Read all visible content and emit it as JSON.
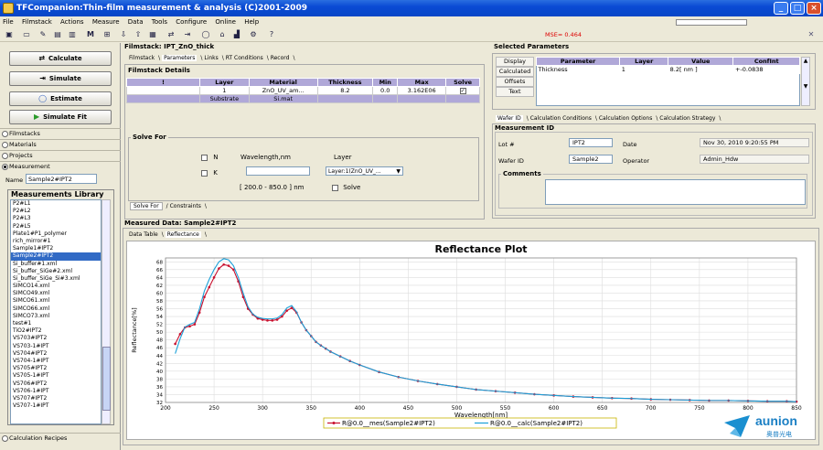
{
  "window": {
    "title": "TFCompanion:Thin-film measurement & analysis (C)2001-2009"
  },
  "menu": [
    "File",
    "Filmstack",
    "Actions",
    "Measure",
    "Data",
    "Tools",
    "Configure",
    "Online",
    "Help"
  ],
  "status": {
    "mse": "MSE= 0.464"
  },
  "left": {
    "buttons": {
      "calculate": "Calculate",
      "simulate": "Simulate",
      "estimate": "Estimate",
      "simulate_fit": "Simulate Fit"
    },
    "nav": [
      "Filmstacks",
      "Materials",
      "Projects",
      "Measurement"
    ],
    "name_label": "Name",
    "name_value": "Sample2#IPT2",
    "library_title": "Measurements Library",
    "library": [
      "P2#L1",
      "P2#L2",
      "P2#L3",
      "P2#L5",
      "Plate1#P1_polymer",
      "rich_mirror#1",
      "Sample1#IPT2",
      "Sample2#IPT2",
      "Si_buffer#1.xml",
      "Si_buffer_SiGe#2.xml",
      "Si_buffer_SiGe_Si#3.xml",
      "SIMCO14.xml",
      "SIMCO49.xml",
      "SIMCO61.xml",
      "SIMCO66.xml",
      "SIMCO73.xml",
      "test#1",
      "TiO2#IPT2",
      "VS703#IPT2",
      "VS703-1#IPT",
      "VS704#IPT2",
      "VS704-1#IPT",
      "VS705#IPT2",
      "VS705-1#IPT",
      "VS706#IPT2",
      "VS706-1#IPT",
      "VS707#IPT2",
      "VS707-1#IPT"
    ],
    "calc_recipes": "Calculation Recipes"
  },
  "filmstack": {
    "title": "Filmstack: IPT_ZnO_thick",
    "tabs": [
      "Filmstack",
      "Parameters",
      "Links",
      "RT Conditions",
      "Record"
    ],
    "details_title": "Filmstack Details",
    "headers": [
      "!",
      "Layer",
      "Material",
      "Thickness",
      "Min",
      "Max",
      "Solve"
    ],
    "row": {
      "layer": "1",
      "material": "ZnO_UV_am...",
      "thickness": "8.2",
      "min": "0.0",
      "max": "3.162E06"
    },
    "substrate": {
      "label": "Substrate",
      "material": "Si.mat"
    },
    "solve_for": {
      "title": "Solve For",
      "n_label": "N",
      "k_label": "K",
      "wavelength_label": "Wavelength,nm",
      "layer_label": "Layer",
      "layer_value": "Layer:1(ZnO_UV_...",
      "range": "[ 200.0 - 850.0 ] nm",
      "solve_label": "Solve"
    },
    "bottom_tabs": [
      "Solve For",
      "Constraints"
    ]
  },
  "selected": {
    "title": "Selected Parameters",
    "side_buttons": [
      "Display",
      "Calculated",
      "Offsets",
      "Text"
    ],
    "headers": [
      "Parameter",
      "Layer",
      "Value",
      "ConfInt"
    ],
    "row": {
      "parameter": "Thickness",
      "layer": "1",
      "value": "8.2[ nm ]",
      "confint": "+-0.0838"
    }
  },
  "wafer": {
    "tabs": [
      "Wafer ID",
      "Calculation Conditions",
      "Calculation Options",
      "Calculation Strategy"
    ],
    "measurement_id": "Measurement ID",
    "lot_label": "Lot #",
    "lot_value": "IPT2",
    "date_label": "Date",
    "date_value": "Nov 30, 2010 9:20:55 PM",
    "wafer_label": "Wafer ID",
    "wafer_value": "Sample2",
    "operator_label": "Operator",
    "operator_value": "Admin_Hdw",
    "comments_label": "Comments"
  },
  "measured": {
    "title": "Measured Data: Sample2#IPT2",
    "tabs": [
      "Data Table",
      "Reflectance"
    ]
  },
  "logo": {
    "text": "aunion",
    "subtext": "奥普光电"
  },
  "colors": {
    "measured": "#c8102e",
    "calculated": "#1aa0d8",
    "accent": "#316ac5"
  },
  "chart_data": {
    "type": "line",
    "title": "Reflectance Plot",
    "xlabel": "Wavelength[nm]",
    "ylabel": "Reflectance[%]",
    "xlim": [
      200,
      850
    ],
    "ylim": [
      32,
      69
    ],
    "xticks": [
      200,
      250,
      300,
      350,
      400,
      450,
      500,
      550,
      600,
      650,
      700,
      750,
      800,
      850
    ],
    "yticks": [
      32,
      34,
      36,
      38,
      40,
      42,
      44,
      46,
      48,
      50,
      52,
      54,
      56,
      58,
      60,
      62,
      64,
      66,
      68
    ],
    "grid": true,
    "legend_position": "bottom",
    "series": [
      {
        "name": "R@0.0__mes(Sample2#IPT2)",
        "x": [
          210,
          215,
          220,
          225,
          230,
          235,
          240,
          245,
          250,
          255,
          260,
          265,
          270,
          275,
          280,
          285,
          290,
          295,
          300,
          305,
          310,
          315,
          320,
          325,
          330,
          335,
          340,
          345,
          350,
          355,
          360,
          365,
          370,
          380,
          390,
          400,
          420,
          440,
          460,
          480,
          500,
          520,
          540,
          560,
          580,
          600,
          620,
          640,
          660,
          680,
          700,
          720,
          740,
          760,
          780,
          800,
          820,
          840,
          850
        ],
        "y": [
          47,
          49.5,
          51.2,
          51.5,
          52,
          55,
          59,
          61.5,
          64,
          66.3,
          67.3,
          67,
          66,
          63,
          59,
          56,
          54.5,
          53.5,
          53.2,
          53,
          53,
          53.2,
          54,
          55.5,
          56.2,
          55,
          52.5,
          50.5,
          49,
          47.5,
          46.6,
          45.8,
          45,
          43.8,
          42.6,
          41.6,
          39.8,
          38.5,
          37.5,
          36.7,
          36,
          35.3,
          34.9,
          34.5,
          34.1,
          33.8,
          33.5,
          33.3,
          33.1,
          33,
          32.8,
          32.7,
          32.6,
          32.5,
          32.5,
          32.4,
          32.3,
          32.3,
          32.2
        ]
      },
      {
        "name": "R@0.0__calc(Sample2#IPT2)",
        "x": [
          210,
          215,
          220,
          225,
          230,
          235,
          240,
          245,
          250,
          255,
          260,
          265,
          270,
          275,
          280,
          285,
          290,
          295,
          300,
          305,
          310,
          315,
          320,
          325,
          330,
          335,
          340,
          345,
          350,
          355,
          360,
          365,
          370,
          380,
          390,
          400,
          420,
          440,
          460,
          480,
          500,
          520,
          540,
          560,
          580,
          600,
          620,
          640,
          660,
          680,
          700,
          720,
          740,
          760,
          780,
          800,
          820,
          840,
          850
        ],
        "y": [
          44.5,
          48.3,
          51.3,
          52,
          52.5,
          56,
          60.5,
          63.5,
          66,
          68,
          68.8,
          68.5,
          67,
          64,
          60,
          56.5,
          54.6,
          53.8,
          53.5,
          53.4,
          53.4,
          53.6,
          54.5,
          56.2,
          56.8,
          55.2,
          52.5,
          50.5,
          49,
          47.5,
          46.6,
          45.8,
          45,
          43.8,
          42.6,
          41.6,
          39.8,
          38.5,
          37.5,
          36.7,
          36,
          35.3,
          34.9,
          34.5,
          34.1,
          33.8,
          33.5,
          33.3,
          33.1,
          33,
          32.8,
          32.7,
          32.6,
          32.5,
          32.5,
          32.4,
          32.3,
          32.3,
          32.2
        ]
      }
    ]
  }
}
